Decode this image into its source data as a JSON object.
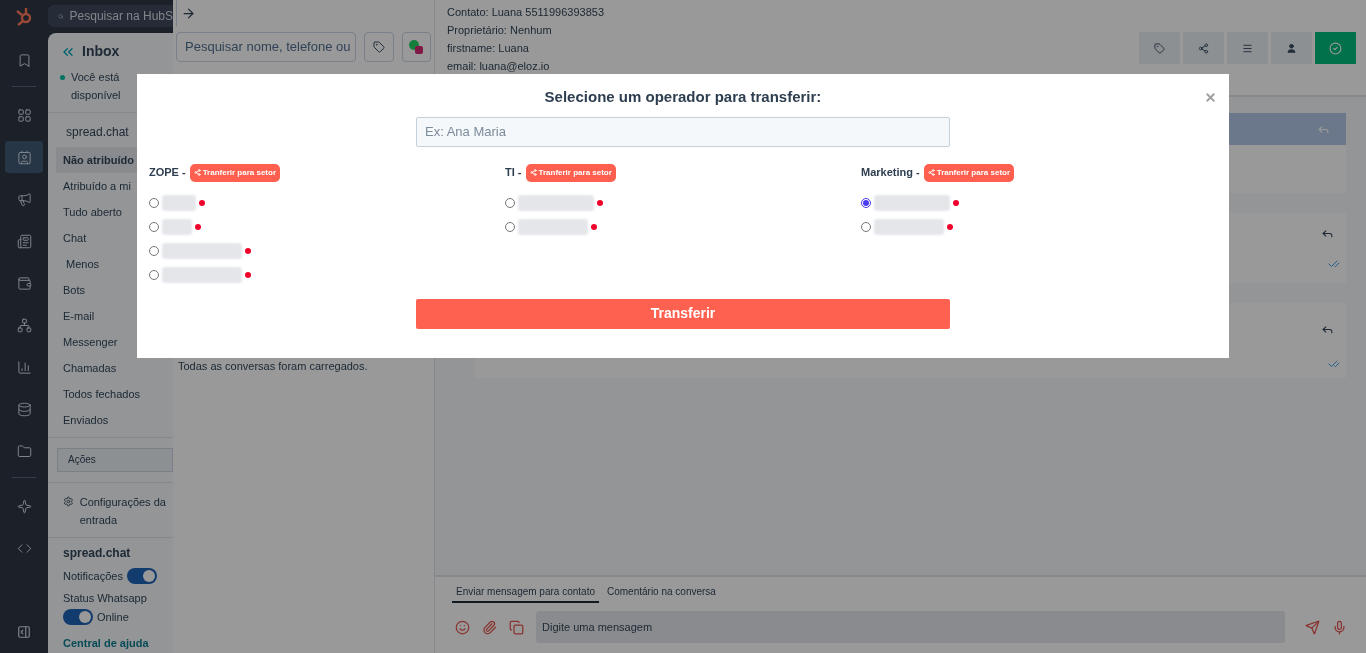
{
  "rail": {
    "search_placeholder": "Pesquisar na HubS",
    "items": [
      {
        "selected": false
      },
      {
        "selected": false
      },
      {
        "selected": true
      },
      {
        "selected": false
      },
      {
        "selected": false
      },
      {
        "selected": false
      },
      {
        "selected": false
      },
      {
        "selected": false
      },
      {
        "selected": false
      },
      {
        "selected": false
      },
      {
        "selected": false
      },
      {
        "selected": false
      }
    ]
  },
  "sidebar": {
    "title": "Inbox",
    "status": "Você está disponível",
    "section": "spread.chat",
    "items": [
      {
        "label": "Não atribuído",
        "selected": true
      },
      {
        "label": "Atribuído a mi",
        "selected": false
      },
      {
        "label": "Tudo aberto",
        "selected": false
      },
      {
        "label": "Chat",
        "selected": false
      },
      {
        "label": " Menos",
        "selected": false
      },
      {
        "label": "Bots",
        "selected": false
      },
      {
        "label": "E-mail",
        "selected": false
      },
      {
        "label": "Messenger",
        "selected": false
      },
      {
        "label": "Chamadas",
        "selected": false
      },
      {
        "label": "Todos fechados",
        "selected": false
      },
      {
        "label": "Enviados",
        "selected": false
      }
    ],
    "actions": "Ações",
    "settings": "Configurações da entrada",
    "brand": "spread.chat",
    "notifications": {
      "label": "Notificações",
      "on": true
    },
    "whatsapp": {
      "label": "Status Whatsapp",
      "on": true,
      "state": "Online"
    },
    "help": "Central de ajuda"
  },
  "middle": {
    "search_placeholder": "Pesquisar nome, telefone ou",
    "footer": "Todas as conversas foram carregados."
  },
  "header": {
    "lines": [
      "Contato: Luana 5511996393853",
      "Proprietário: Nenhum",
      "firstname: Luana",
      "email: luana@eloz.io"
    ]
  },
  "composer": {
    "tabs": [
      {
        "label": "Enviar mensagem para contato",
        "selected": true
      },
      {
        "label": "Comentário na conversa",
        "selected": false
      }
    ],
    "placeholder": "Digite uma mensagem"
  },
  "modal": {
    "title": "Selecione um operador para transferir:",
    "search_placeholder": "Ex: Ana Maria",
    "submit": "Transferir",
    "groups": [
      {
        "label": "ZOPE -",
        "action": "Tranferir para setor",
        "operators": [
          {
            "selected": false,
            "color": "#f0002a"
          },
          {
            "selected": false,
            "color": "#f0002a"
          },
          {
            "selected": false,
            "color": "#f0002a"
          },
          {
            "selected": false,
            "color": "#f0002a"
          }
        ]
      },
      {
        "label": "TI -",
        "action": "Tranferir para setor",
        "operators": [
          {
            "selected": false,
            "color": "#f0002a"
          },
          {
            "selected": false,
            "color": "#f0002a"
          }
        ]
      },
      {
        "label": "Marketing -",
        "action": "Tranferir para setor",
        "operators": [
          {
            "selected": true,
            "color": "#f0002a"
          },
          {
            "selected": false,
            "color": "#f0002a"
          }
        ]
      }
    ]
  }
}
